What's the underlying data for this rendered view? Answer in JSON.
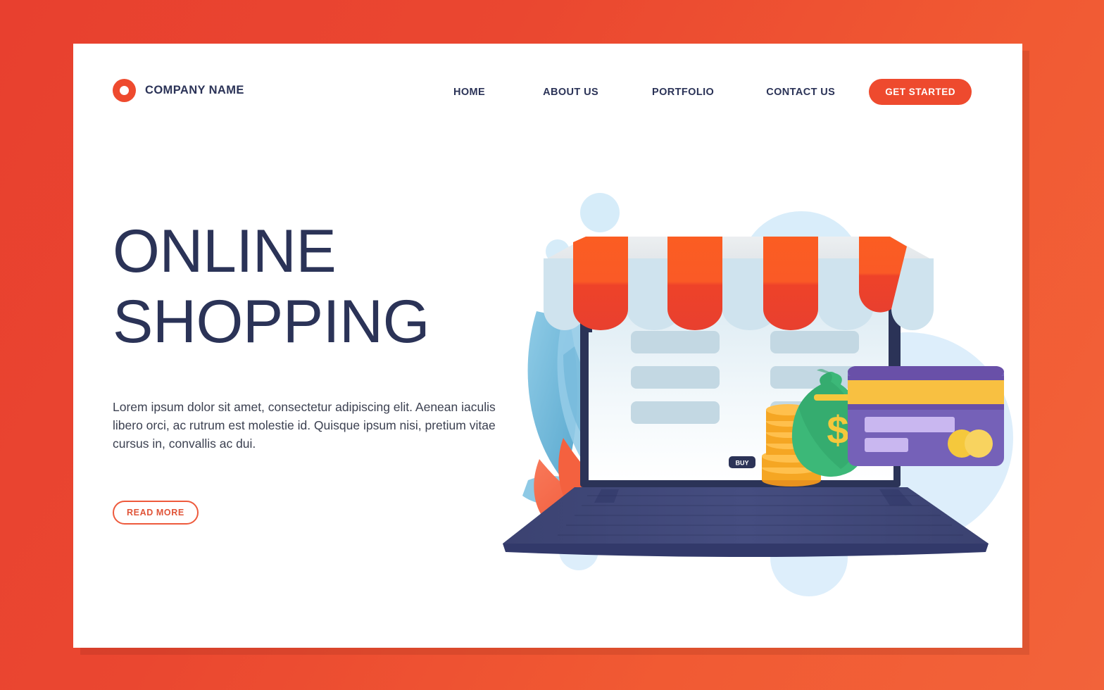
{
  "page": {
    "background_color": "#ea4730",
    "card_color": "#ffffff"
  },
  "header": {
    "logo_icon": "ring-logo-icon",
    "brand_name": "COMPANY NAME",
    "nav_items": [
      {
        "label": "HOME"
      },
      {
        "label": "ABOUT US"
      },
      {
        "label": "PORTFOLIO"
      },
      {
        "label": "CONTACT US"
      }
    ],
    "cta_label": "GET STARTED",
    "accent_color": "#ee4a2e",
    "text_color": "#2b3357"
  },
  "hero": {
    "title_line1": "ONLINE",
    "title_line2": "SHOPPING",
    "paragraph": "Lorem ipsum dolor sit amet, consectetur adipiscing elit. Aenean iaculis libero orci, ac rutrum est molestie id. Quisque ipsum nisi, pretium vitae cursus in, convallis ac dui.",
    "button_label": "READ MORE",
    "title_color": "#2b3357",
    "button_border_color": "#ee5a3c"
  },
  "illustration": {
    "name": "online-shopping-laptop-storefront-illustration",
    "screen_buy_label": "BUY",
    "awning_stripe_color": "#ee4229",
    "awning_stripe_top_color": "#fa5a26",
    "awning_light_color": "#cfe3ee",
    "laptop_base_color": "#3e4577",
    "laptop_frame_color": "#2b3357",
    "card_color": "#7561b8",
    "card_stripe_color": "#f8c041",
    "moneybag_color": "#3cb878",
    "coin_color": "#f5a623",
    "bubble_color": "#d6ecf9",
    "leaf_blue_color": "#7fc2e0",
    "leaf_orange_color": "#f4613f"
  }
}
